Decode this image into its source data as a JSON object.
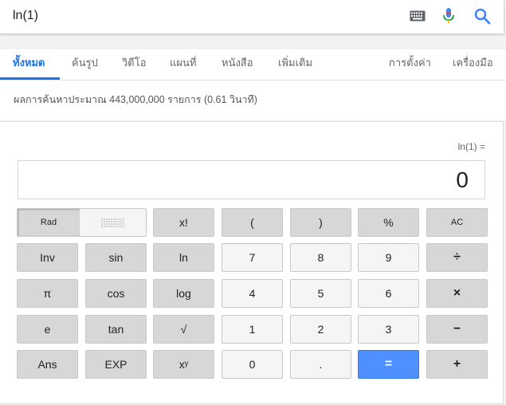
{
  "search": {
    "query": "ln(1)"
  },
  "icons": {
    "keyboard": "keyboard-icon",
    "mic": "microphone-icon",
    "search": "search-icon"
  },
  "colors": {
    "accent": "#1a73e8",
    "equals": "#4d90fe",
    "mic_blue": "#4285f4",
    "mic_red": "#ea4335",
    "mic_yellow": "#fbbc05",
    "mic_green": "#34a853"
  },
  "tabs": {
    "all": "ทั้งหมด",
    "images": "ค้นรูป",
    "videos": "วิดีโอ",
    "maps": "แผนที่",
    "books": "หนังสือ",
    "more": "เพิ่มเติม",
    "settings": "การตั้งค่า",
    "tools": "เครื่องมือ"
  },
  "result_stats": "ผลการค้นหาประมาณ 443,000,000 รายการ (0.61 วินาที)",
  "calculator": {
    "expression": "ln(1) =",
    "result": "0",
    "mode_rad": "Rad",
    "buttons": {
      "factorial": "x!",
      "open_paren": "(",
      "close_paren": ")",
      "percent": "%",
      "clear": "AC",
      "inv": "Inv",
      "sin": "sin",
      "ln": "ln",
      "seven": "7",
      "eight": "8",
      "nine": "9",
      "divide": "÷",
      "pi": "π",
      "cos": "cos",
      "log": "log",
      "four": "4",
      "five": "5",
      "six": "6",
      "multiply": "×",
      "e": "e",
      "tan": "tan",
      "sqrt": "√",
      "one": "1",
      "two": "2",
      "three": "3",
      "minus": "−",
      "ans": "Ans",
      "exp": "EXP",
      "power": "xʸ",
      "zero": "0",
      "dot": ".",
      "equals": "=",
      "plus": "+"
    }
  }
}
